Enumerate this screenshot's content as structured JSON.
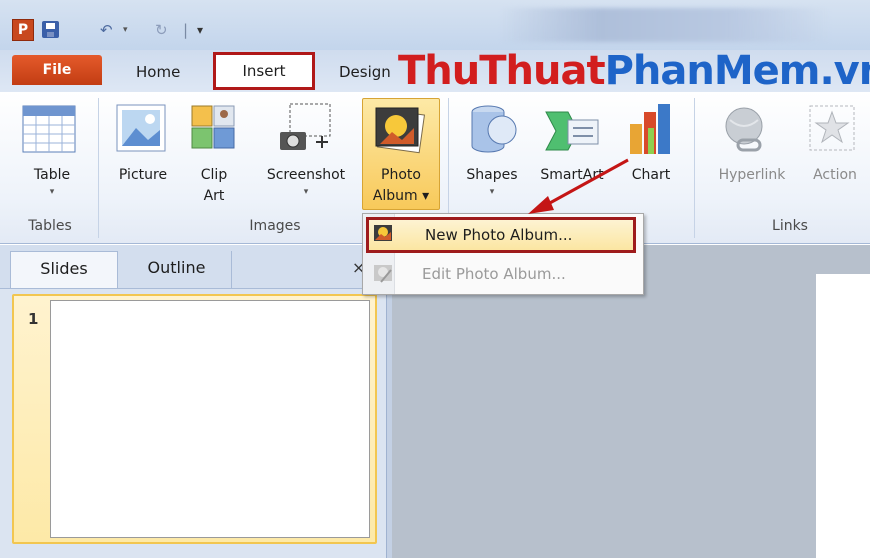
{
  "qat": {
    "app_letter": "P",
    "undo": "↶",
    "undo_drop": "▾",
    "redo": "↻",
    "sep": "|",
    "customize": "▾"
  },
  "tabs": {
    "file": "File",
    "home": "Home",
    "insert": "Insert",
    "design": "Design"
  },
  "watermark": {
    "part1": "ThuThuat",
    "part2": "PhanMem",
    "part3": ".vn"
  },
  "ribbon": {
    "table": {
      "label": "Table",
      "drop": "▾"
    },
    "picture": {
      "label": "Picture"
    },
    "clipart": {
      "line1": "Clip",
      "line2": "Art"
    },
    "screenshot": {
      "label": "Screenshot",
      "drop": "▾"
    },
    "photo_album": {
      "line1": "Photo",
      "line2": "Album ▾"
    },
    "shapes": {
      "label": "Shapes",
      "drop": "▾"
    },
    "smartart": {
      "label": "SmartArt"
    },
    "chart": {
      "label": "Chart"
    },
    "hyperlink": {
      "label": "Hyperlink"
    },
    "action": {
      "label": "Action"
    },
    "groups": {
      "tables": "Tables",
      "images": "Images",
      "links": "Links"
    }
  },
  "pane": {
    "tab_slides": "Slides",
    "tab_outline": "Outline",
    "close": "×",
    "slide_number": "1"
  },
  "menu": {
    "new_photo_album": "New Photo Album...",
    "edit_photo_album": "Edit Photo Album..."
  },
  "colors": {
    "highlight_red": "#b01818",
    "file_orange": "#d24a1c",
    "watermark_red": "#d21e1e",
    "watermark_blue": "#1e64c8"
  }
}
